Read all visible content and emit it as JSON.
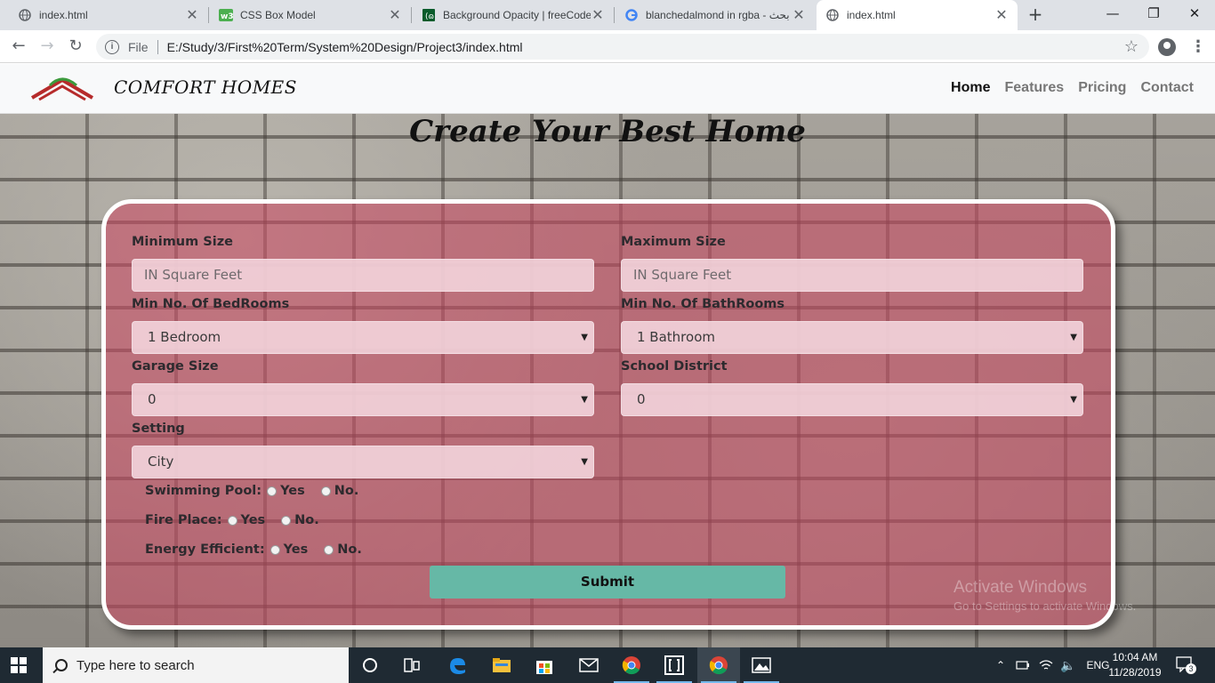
{
  "browser": {
    "tabs": [
      {
        "title": "index.html",
        "icon": "globe-icon",
        "active": false
      },
      {
        "title": "CSS Box Model",
        "icon": "w3schools-icon",
        "active": false
      },
      {
        "title": "Background Opacity | freeCode",
        "icon": "freecodecamp-icon",
        "active": false
      },
      {
        "title": "blanchedalmond in rgba - بحث",
        "icon": "google-icon",
        "active": false
      },
      {
        "title": "index.html",
        "icon": "globe-icon",
        "active": true
      }
    ],
    "close_glyph": "✕",
    "new_tab_glyph": "+",
    "address": {
      "scheme_label": "File",
      "url": "E:/Study/3/First%20Term/System%20Design/Project3/index.html"
    }
  },
  "site": {
    "brand": "COMFORT HOMES",
    "nav": [
      {
        "label": "Home",
        "active": true
      },
      {
        "label": "Features",
        "active": false
      },
      {
        "label": "Pricing",
        "active": false
      },
      {
        "label": "Contact",
        "active": false
      }
    ],
    "heading": "Create Your Best Home"
  },
  "form": {
    "min_size": {
      "label": "Minimum Size",
      "placeholder": "IN Square Feet"
    },
    "max_size": {
      "label": "Maximum Size",
      "placeholder": "IN Square Feet"
    },
    "bedrooms": {
      "label": "Min No. Of BedRooms",
      "value": "1 Bedroom"
    },
    "bathrooms": {
      "label": "Min No. Of BathRooms",
      "value": "1 Bathroom"
    },
    "garage": {
      "label": "Garage Size",
      "value": "0"
    },
    "school": {
      "label": "School District",
      "value": "0"
    },
    "setting": {
      "label": "Setting",
      "value": "City"
    },
    "radios": [
      {
        "label": "Swimming Pool:",
        "yes": "Yes",
        "no": "No."
      },
      {
        "label": "Fire Place:",
        "yes": "Yes",
        "no": "No."
      },
      {
        "label": "Energy Efficient:",
        "yes": "Yes",
        "no": "No."
      }
    ],
    "submit_label": "Submit",
    "select_caret": "▼"
  },
  "watermark": {
    "line1": "Activate Windows",
    "line2": "Go to Settings to activate Windows."
  },
  "taskbar": {
    "search_placeholder": "Type here to search",
    "language": "ENG",
    "time": "10:04 AM",
    "date": "11/28/2019",
    "notifications": "3"
  },
  "colors": {
    "form_overlay": "#c84860",
    "submit": "#66b8a6",
    "navbar": "#f8f9fa"
  }
}
